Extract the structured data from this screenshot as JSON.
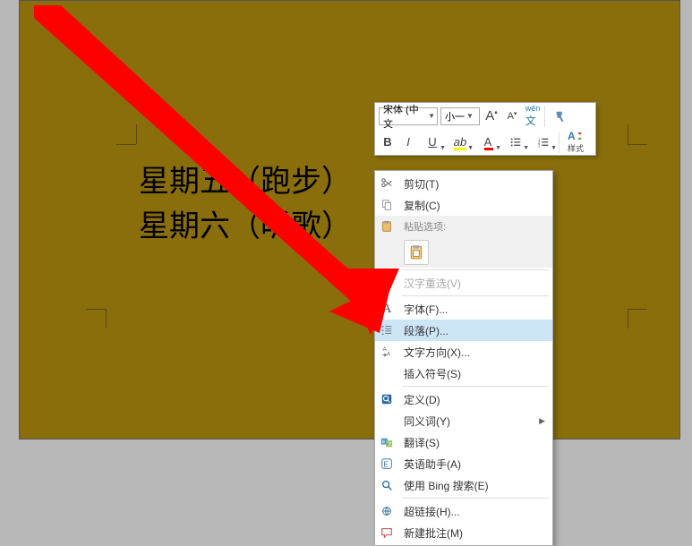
{
  "document": {
    "line1": "星期五（跑步）",
    "line2": "星期六（听歌）"
  },
  "mini_toolbar": {
    "font_family": "宋体 (中文",
    "font_size": "小一",
    "grow": "A",
    "shrink": "A",
    "phonetic": "wén",
    "bold": "B",
    "italic": "I",
    "underline": "U",
    "highlight": "A",
    "fontcolor": "A",
    "styles_label": "样式"
  },
  "context_menu": {
    "cut": "剪切(T)",
    "copy": "复制(C)",
    "paste_options_label": "粘贴选项:",
    "hanzi_reselect": "汉字重选(V)",
    "font": "字体(F)...",
    "paragraph": "段落(P)...",
    "text_direction": "文字方向(X)...",
    "insert_symbol": "插入符号(S)",
    "define": "定义(D)",
    "synonyms": "同义词(Y)",
    "translate": "翻译(S)",
    "english_assistant": "英语助手(A)",
    "bing_search": "使用 Bing 搜索(E)",
    "hyperlink": "超链接(H)...",
    "new_comment": "新建批注(M)"
  },
  "chart_data": null
}
